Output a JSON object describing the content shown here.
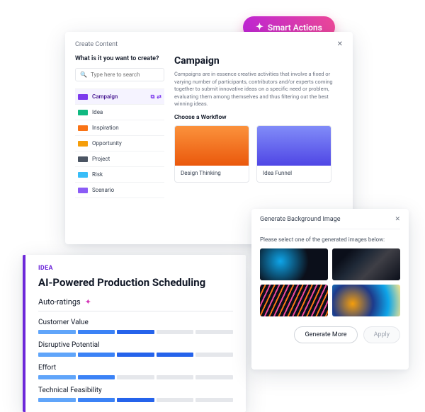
{
  "smart_actions": {
    "label": "Smart Actions"
  },
  "create": {
    "header_title": "Create Content",
    "prompt": "What is it you want to create?",
    "search_placeholder": "Type here to search",
    "types": [
      {
        "label": "Campaign",
        "color": "#7c3aed",
        "selected": true
      },
      {
        "label": "Idea",
        "color": "#10b981"
      },
      {
        "label": "Inspiration",
        "color": "#f97316"
      },
      {
        "label": "Opportunity",
        "color": "#f59e0b"
      },
      {
        "label": "Project",
        "color": "#4b5563"
      },
      {
        "label": "Risk",
        "color": "#38bdf8"
      },
      {
        "label": "Scenario",
        "color": "#8b5cf6"
      }
    ],
    "headline": "Campaign",
    "description": "Campaigns are in essence creative activities that involve a fixed or varying number of participants, contributors and/or experts coming together to submit innovative ideas on a specific need or problem, evaluating them among themselves and thus filtering out the best winning ideas.",
    "workflow_label": "Choose a Workflow",
    "workflows": [
      {
        "name": "Design Thinking"
      },
      {
        "name": "Idea Funnel"
      }
    ]
  },
  "idea": {
    "chip": "IDEA",
    "title": "AI-Powered Production Scheduling",
    "auto_label": "Auto-ratings",
    "metrics": [
      {
        "label": "Customer Value",
        "filled": 3
      },
      {
        "label": "Disruptive Potential",
        "filled": 4
      },
      {
        "label": "Effort",
        "filled": 2
      },
      {
        "label": "Technical Feasibility",
        "filled": 3
      }
    ],
    "segments_total": 5
  },
  "gen": {
    "title": "Generate Background Image",
    "hint": "Please select one of the generated images below:",
    "generate_more": "Generate More",
    "apply": "Apply"
  }
}
